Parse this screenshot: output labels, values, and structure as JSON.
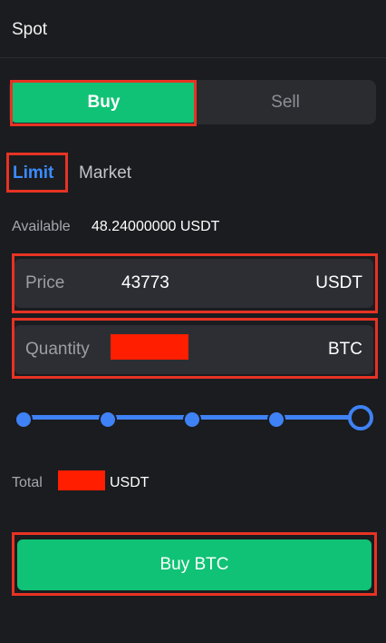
{
  "header": {
    "title": "Spot"
  },
  "side_tabs": {
    "buy_label": "Buy",
    "sell_label": "Sell",
    "selected": "Buy"
  },
  "order_types": {
    "limit_label": "Limit",
    "market_label": "Market",
    "selected": "Limit"
  },
  "available": {
    "label": "Available",
    "value": "48.24000000 USDT"
  },
  "price": {
    "label": "Price",
    "value": "43773",
    "unit": "USDT"
  },
  "quantity": {
    "label": "Quantity",
    "value": "",
    "unit": "BTC"
  },
  "slider": {
    "level_percent": 100,
    "stops": [
      0,
      25,
      50,
      75,
      100
    ]
  },
  "total": {
    "label": "Total",
    "value": "",
    "unit": "USDT"
  },
  "submit": {
    "label": "Buy BTC"
  },
  "colors": {
    "background": "#1b1c1f",
    "buy_green": "#10c275",
    "accent_blue": "#3a8cff",
    "highlight_red": "#e63324",
    "redaction_red": "#ff1e00"
  }
}
